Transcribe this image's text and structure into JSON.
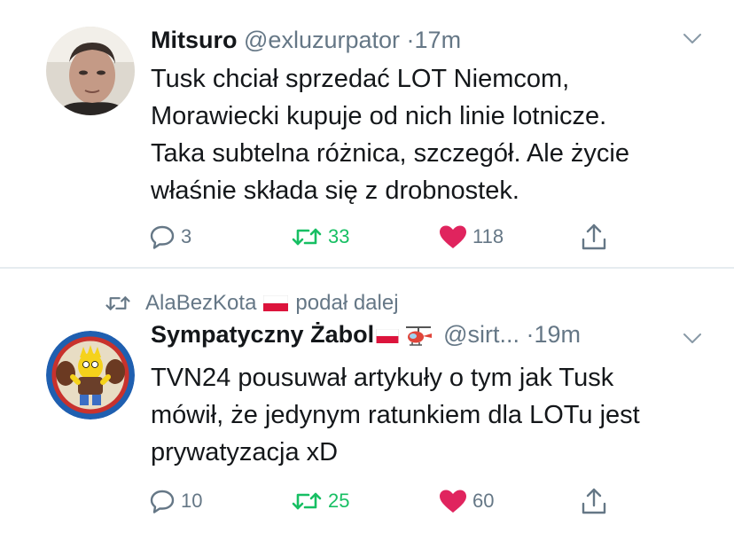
{
  "tweets": [
    {
      "author": {
        "name": "Mitsuro",
        "handle": "@exluzurpator",
        "time": "17m"
      },
      "text": "Tusk chciał sprzedać LOT Niemcom,\nMorawiecki kupuje od nich linie lotnicze.\nTaka subtelna różnica, szczegół. Ale życie\nwłaśnie składa się z drobnostek.",
      "stats": {
        "replies": "3",
        "retweets": "33",
        "likes": "118"
      }
    },
    {
      "retweeted_by": {
        "name": "AlaBezKota",
        "label": "podał dalej"
      },
      "author": {
        "name": "Sympatyczny Żabol",
        "handle": "@sirt...",
        "time": "19m"
      },
      "text": "TVN24 pousuwał artykuły o tym jak Tusk\nmówił, że jedynym ratunkiem dla LOTu jest\nprywatyzacja xD",
      "stats": {
        "replies": "10",
        "retweets": "25",
        "likes": "60"
      }
    }
  ],
  "separator": "·",
  "colors": {
    "retweet": "#17bf63",
    "like": "#e0245e",
    "muted": "#657786",
    "text": "#14171a"
  },
  "icons": [
    "reply-icon",
    "retweet-icon",
    "heart-icon",
    "share-icon",
    "chevron-down-icon",
    "poland-flag-icon",
    "helicopter-icon"
  ]
}
